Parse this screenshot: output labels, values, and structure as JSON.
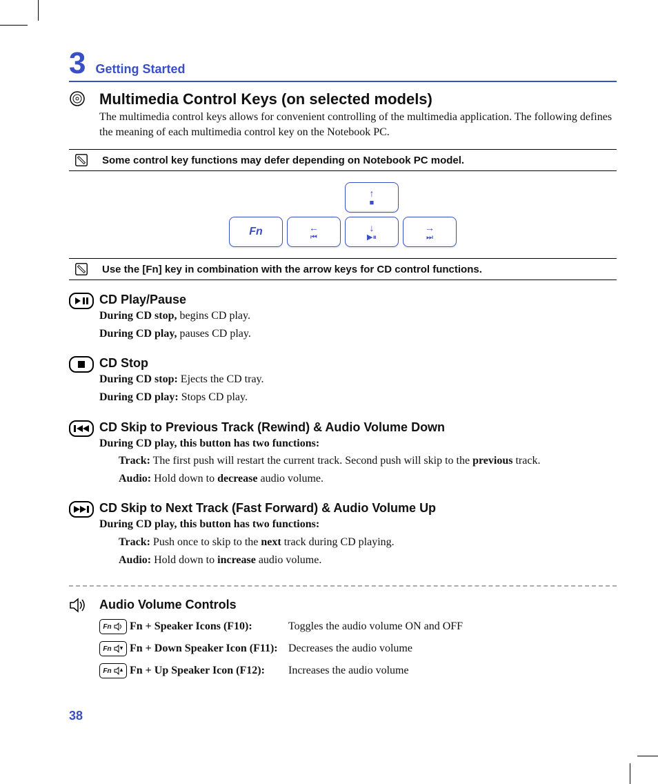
{
  "chapter": {
    "num": "3",
    "title": "Getting Started"
  },
  "main_section": {
    "title": "Multimedia Control Keys (on selected models)",
    "body": "The multimedia control keys allows for convenient controlling of the multimedia application. The following defines the meaning of each multimedia control key on the Notebook PC."
  },
  "note1": "Some control key functions may defer depending on Notebook PC model.",
  "note2": "Use the [Fn] key in combination with the arrow keys for CD control functions.",
  "keyboard": {
    "fn_label": "Fn",
    "up": {
      "arrow": "↑",
      "glyph": "■"
    },
    "left": {
      "arrow": "←",
      "glyph": "⏮"
    },
    "down": {
      "arrow": "↓",
      "glyph": "▶⏸"
    },
    "right": {
      "arrow": "→",
      "glyph": "⏭"
    }
  },
  "sections": {
    "play": {
      "title": "CD Play/Pause",
      "l1a": "During CD stop,",
      "l1b": " begins CD play.",
      "l2a": "During CD play,",
      "l2b": " pauses CD play."
    },
    "stop": {
      "title": "CD Stop",
      "l1a": "During CD stop:",
      "l1b": " Ejects the CD tray.",
      "l2a": "During CD play:",
      "l2b": " Stops CD play."
    },
    "prev": {
      "title": "CD Skip to Previous Track (Rewind) & Audio Volume Down",
      "lead": "During CD play, this button has two functions:",
      "t1a": "Track:",
      "t1b": " The first push will restart the current track. Second push will skip to the ",
      "t1bold": "previous",
      "t1c": " track.",
      "a1a": "Audio:",
      "a1b": " Hold down to ",
      "a1bold": "decrease",
      "a1c": " audio volume."
    },
    "next": {
      "title": "CD Skip to Next Track (Fast Forward) & Audio Volume Up",
      "lead": "During CD play, this button has two functions:",
      "t1a": "Track:",
      "t1b": " Push once to skip to the ",
      "t1bold": "next",
      "t1c": " track during CD playing.",
      "a1a": "Audio:",
      "a1b": " Hold down to ",
      "a1bold": "increase",
      "a1c": " audio volume."
    }
  },
  "volume": {
    "title": "Audio Volume Controls",
    "fn_label": "Fn",
    "rows": [
      {
        "label": "Fn + Speaker Icons (F10):",
        "desc": "Toggles the audio volume ON and OFF"
      },
      {
        "label": "Fn + Down Speaker Icon (F11):",
        "desc": "Decreases the audio volume"
      },
      {
        "label": "Fn + Up Speaker Icon (F12):",
        "desc": "Increases the audio volume"
      }
    ]
  },
  "page_number": "38"
}
